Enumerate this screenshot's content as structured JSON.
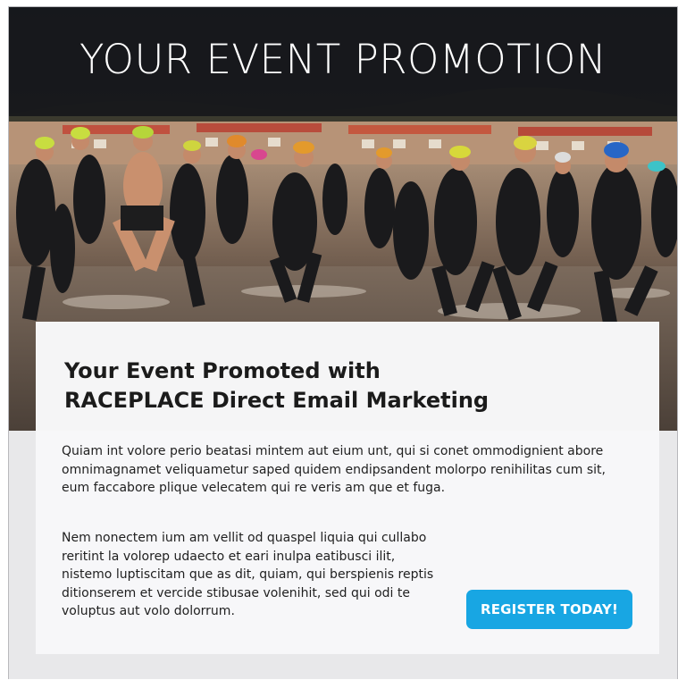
{
  "hero": {
    "title": "YOUR EVENT PROMOTION",
    "photo_subject": "triathletes in wetsuits and swim caps running into the ocean"
  },
  "card": {
    "heading_line1": "Your Event Promoted with",
    "heading_line2": "RACEPLACE Direct Email Marketing",
    "paragraph1": "Quiam int volore perio beatasi mintem aut eium unt, qui si conet ommodignient abore omnimagnamet veliquametur saped quidem endipsandent molorpo renihilitas cum sit, eum faccabore plique velecatem qui re veris am que et fuga.",
    "paragraph2": "Nem nonectem ium am vellit od quaspel liquia qui cullabo reritint la volorep udaecto et eari inulpa eatibusci ilit, nistemo luptiscitam que as dit, quiam, qui berspienis reptis ditionserem et vercide stibusae volenihit, sed qui odi te voluptus aut volo dolorrum.",
    "cta_label": "REGISTER TODAY!"
  },
  "colors": {
    "cta_background": "#18a6e3",
    "title_band": "#121418",
    "page_background": "#e8e8ea"
  }
}
